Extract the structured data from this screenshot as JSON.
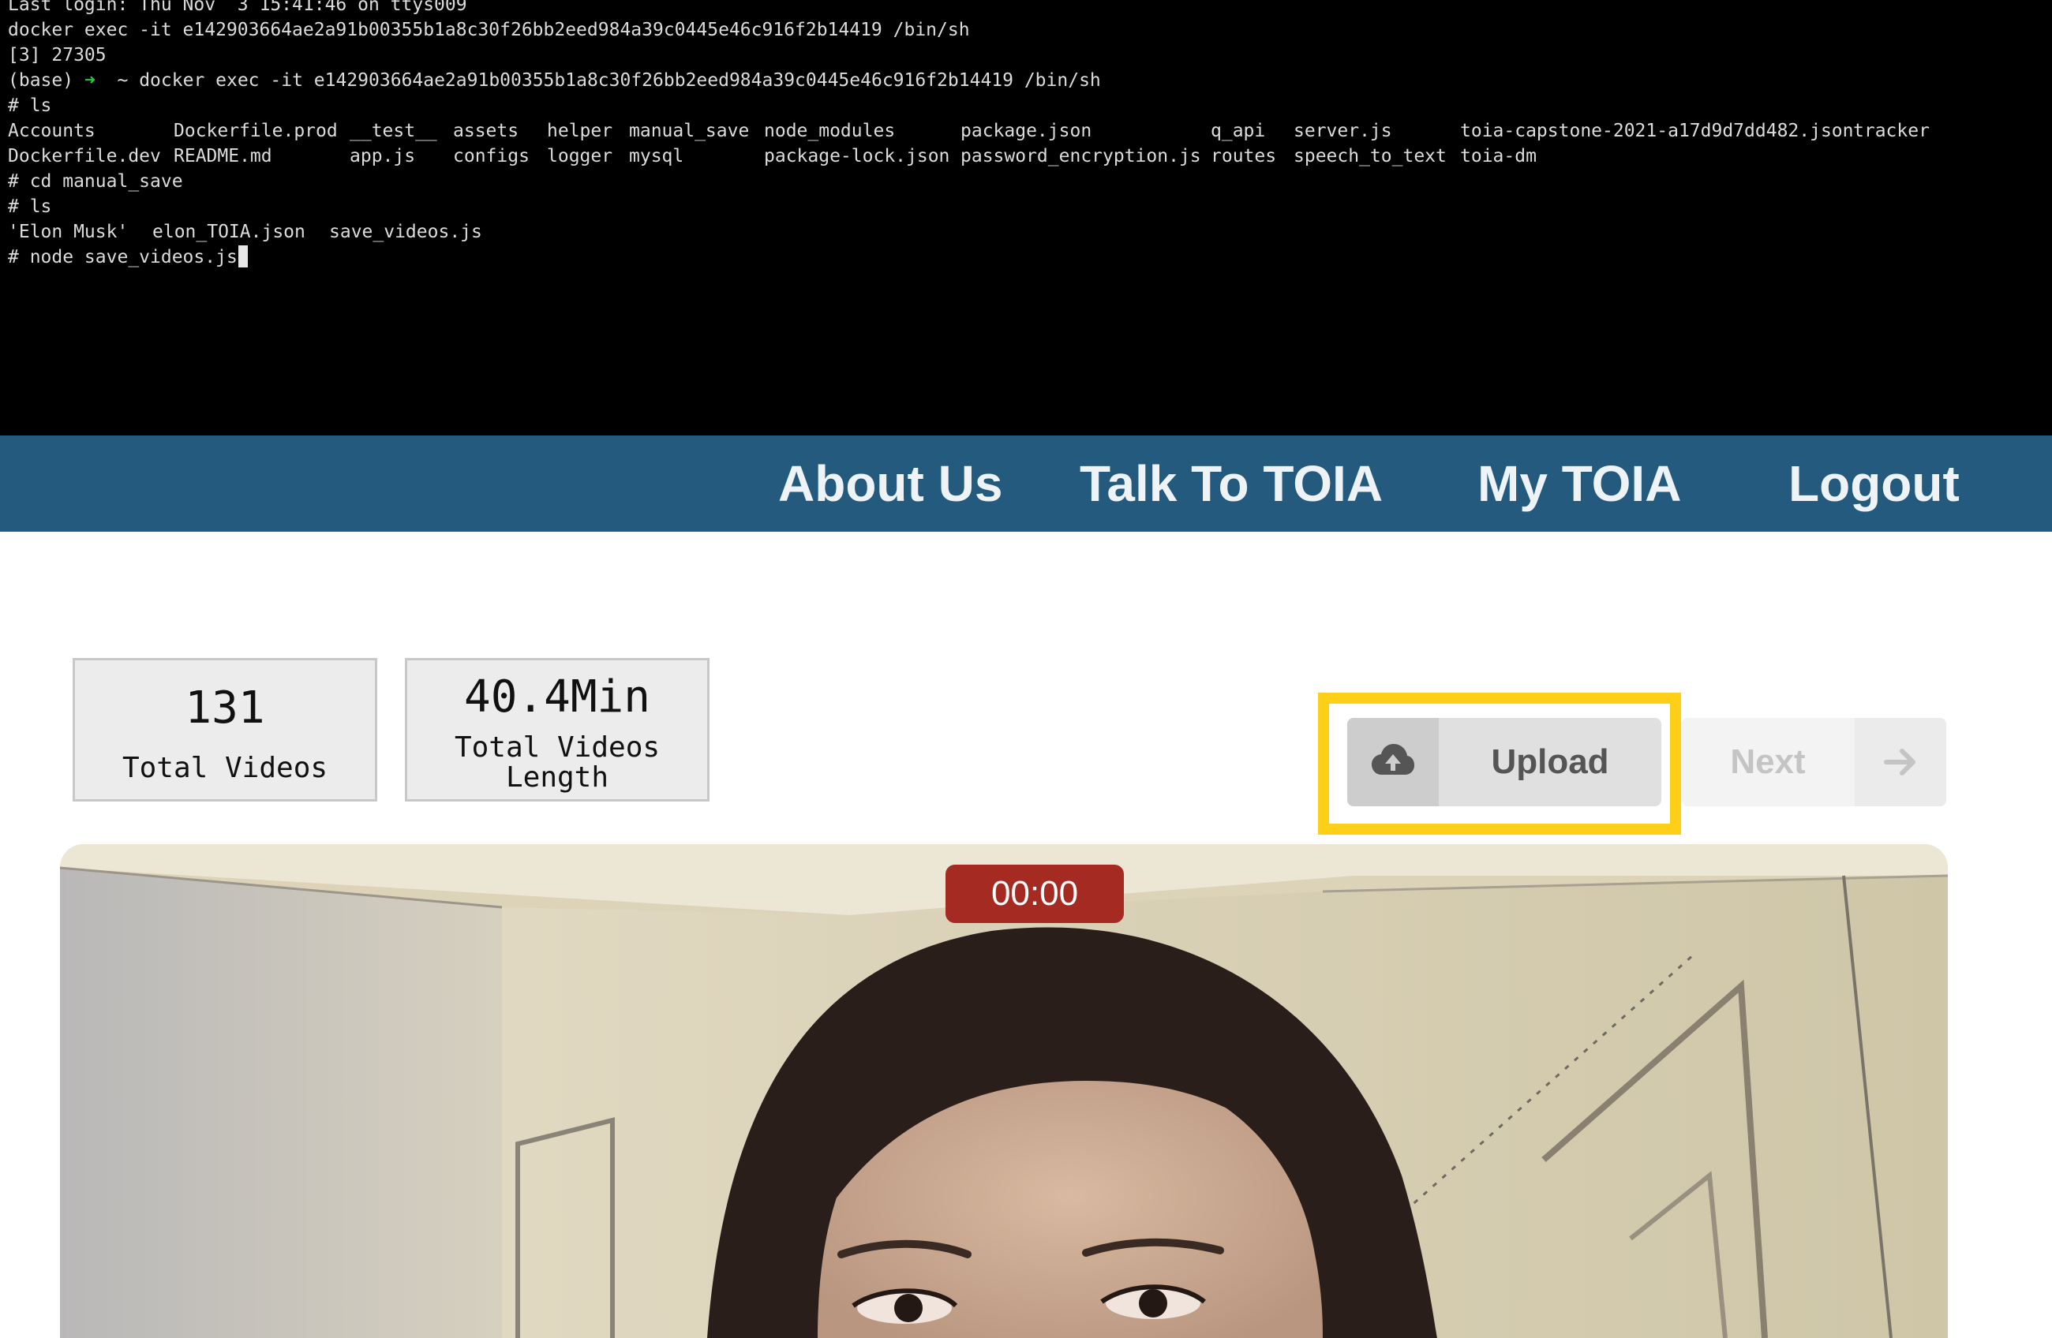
{
  "terminal": {
    "lines": [
      "Last login: Thu Nov  3 15:41:46 on ttys009",
      "docker exec -it e142903664ae2a91b00355b1a8c30f26bb2eed984a39c0445e46c916f2b14419 /bin/sh",
      "[3] 27305",
      "~ docker exec -it e142903664ae2a91b00355b1a8c30f26bb2eed984a39c0445e46c916f2b14419 /bin/sh",
      "# ls",
      "# cd manual_save",
      "# ls",
      "# node save_videos.js"
    ],
    "prompt_prefix": "(base)",
    "prompt_arrow": "➜",
    "ls_row_1": [
      "Accounts",
      "Dockerfile.prod",
      "__test__",
      "assets",
      "helper",
      "manual_save",
      "node_modules",
      "package.json",
      "q_api",
      "server.js",
      "toia-capstone-2021-a17d9d7dd482.json",
      "tracker"
    ],
    "ls_row_2": [
      "Dockerfile.dev",
      "README.md",
      "app.js",
      "configs",
      "logger",
      "mysql",
      "package-lock.json",
      "password_encryption.js",
      "routes",
      "speech_to_text",
      "toia-dm"
    ],
    "ls_manual_save": [
      "'Elon Musk'",
      "elon_TOIA.json",
      "save_videos.js"
    ]
  },
  "nav": {
    "about": "About Us",
    "talk": "Talk To TOIA",
    "my_toia": "My TOIA",
    "logout": "Logout"
  },
  "stats": {
    "total_videos_value": "131",
    "total_videos_label": "Total Videos",
    "length_value": "40.4Min",
    "length_label_line1": "Total Videos",
    "length_label_line2": "Length"
  },
  "actions": {
    "upload_label": "Upload",
    "upload_icon": "cloud-upload-icon",
    "next_label": "Next",
    "next_icon": "arrow-right-icon"
  },
  "video": {
    "timer": "00:00"
  },
  "colors": {
    "navbar": "#235a7d",
    "highlight": "#fdd017",
    "timer": "#a52a22",
    "terminal_bg": "#000000"
  }
}
